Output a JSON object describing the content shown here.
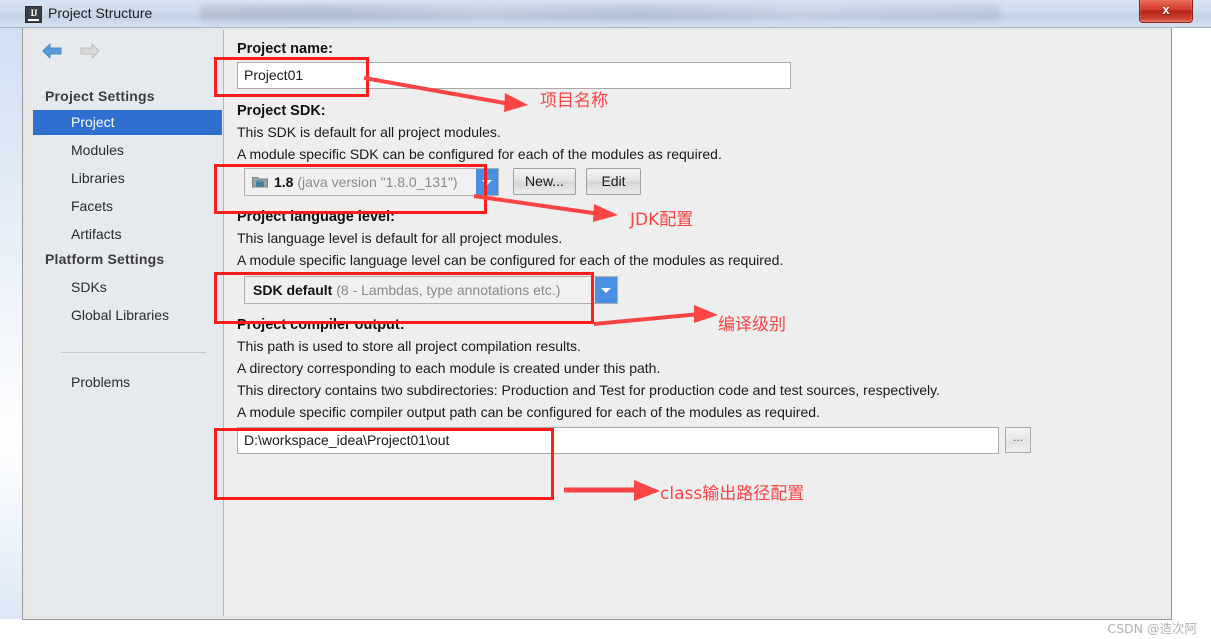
{
  "window": {
    "title": "Project Structure",
    "app_icon": "intellij-idea-icon",
    "close_label": "x"
  },
  "sidebar": {
    "back_icon": "back-arrow-icon",
    "forward_icon": "forward-arrow-icon",
    "groups": [
      {
        "label": "Project Settings"
      },
      {
        "label": "Platform Settings"
      }
    ],
    "items": [
      {
        "label": "Project",
        "selected": true
      },
      {
        "label": "Modules",
        "selected": false
      },
      {
        "label": "Libraries",
        "selected": false
      },
      {
        "label": "Facets",
        "selected": false
      },
      {
        "label": "Artifacts",
        "selected": false
      },
      {
        "label": "SDKs",
        "selected": false
      },
      {
        "label": "Global Libraries",
        "selected": false
      },
      {
        "label": "Problems",
        "selected": false
      }
    ]
  },
  "main": {
    "project_name": {
      "label": "Project name:",
      "value": "Project01"
    },
    "project_sdk": {
      "label": "Project SDK:",
      "desc1": "This SDK is default for all project modules.",
      "desc2": "A module specific SDK can be configured for each of the modules as required.",
      "value_strong": "1.8",
      "value_muted": "(java version \"1.8.0_131\")",
      "new_button": "New...",
      "edit_button": "Edit"
    },
    "language_level": {
      "label": "Project language level:",
      "desc1": "This language level is default for all project modules.",
      "desc2": "A module specific language level can be configured for each of the modules as required.",
      "value_strong": "SDK default",
      "value_muted": "(8 - Lambdas, type annotations etc.)"
    },
    "compiler_output": {
      "label": "Project compiler output:",
      "desc1": "This path is used to store all project compilation results.",
      "desc2": "A directory corresponding to each module is created under this path.",
      "desc3": "This directory contains two subdirectories: Production and Test for production code and test sources, respectively.",
      "desc4": "A module specific compiler output path can be configured for each of the modules as required.",
      "value": "D:\\workspace_idea\\Project01\\out",
      "browse_label": "..."
    }
  },
  "annotations": {
    "accent_color": "#fd1d1d",
    "text_color": "#fb4444",
    "callouts": [
      {
        "text": "项目名称"
      },
      {
        "text": "JDK配置"
      },
      {
        "text": "编译级别"
      },
      {
        "text": "class输出路径配置"
      }
    ]
  },
  "watermark": {
    "text": "CSDN @造次阿"
  }
}
